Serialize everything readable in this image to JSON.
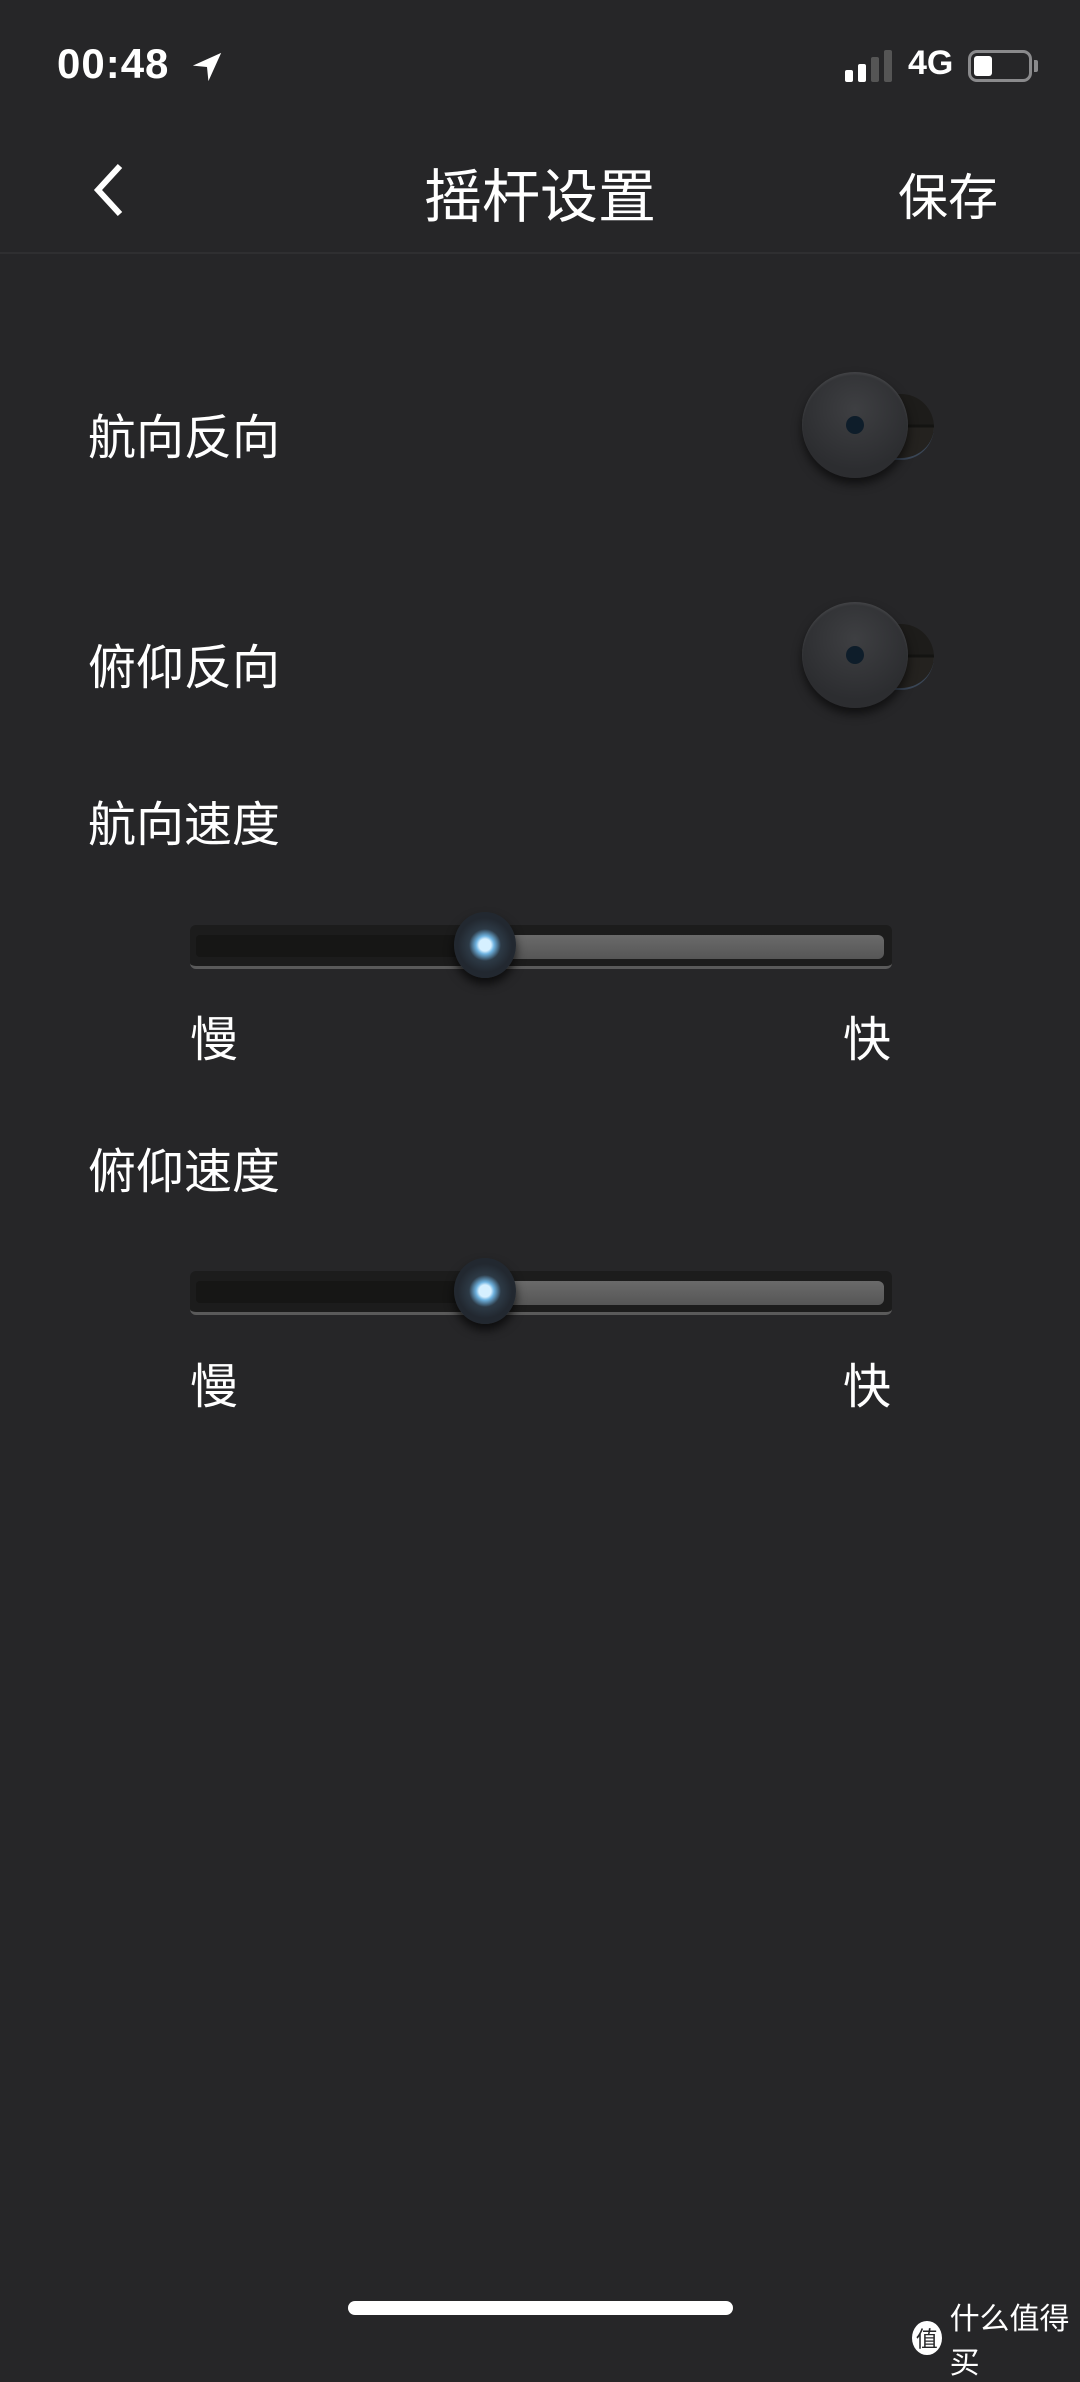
{
  "status_bar": {
    "time": "00:48",
    "network": "4G",
    "signal_bars": 2,
    "signal_total": 4,
    "battery_percent": 35
  },
  "nav": {
    "title": "摇杆设置",
    "save_label": "保存",
    "back_icon": "chevron-left-icon"
  },
  "settings": {
    "yaw_reverse": {
      "label": "航向反向",
      "on": false
    },
    "pitch_reverse": {
      "label": "俯仰反向",
      "on": false
    },
    "yaw_speed": {
      "label": "航向速度",
      "min_label": "慢",
      "max_label": "快",
      "value": 0.42
    },
    "pitch_speed": {
      "label": "俯仰速度",
      "min_label": "慢",
      "max_label": "快",
      "value": 0.42
    }
  },
  "watermark": {
    "logo": "值",
    "text": "什么值得买"
  }
}
